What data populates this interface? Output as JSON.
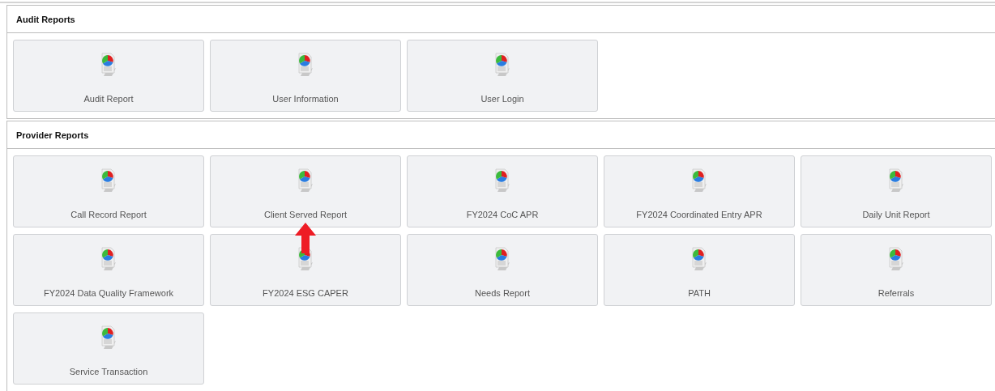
{
  "sections": [
    {
      "title": "Audit Reports",
      "tiles": [
        {
          "label": "Audit Report",
          "marked": false
        },
        {
          "label": "User Information",
          "marked": false
        },
        {
          "label": "User Login",
          "marked": false
        }
      ]
    },
    {
      "title": "Provider Reports",
      "tiles": [
        {
          "label": "Call Record Report",
          "marked": false
        },
        {
          "label": "Client Served Report",
          "marked": true
        },
        {
          "label": "FY2024 CoC APR",
          "marked": false
        },
        {
          "label": "FY2024 Coordinated Entry APR",
          "marked": false
        },
        {
          "label": "Daily Unit Report",
          "marked": false
        },
        {
          "label": "FY2024 Data Quality Framework",
          "marked": false
        },
        {
          "label": "FY2024 ESG CAPER",
          "marked": false
        },
        {
          "label": "Needs Report",
          "marked": false
        },
        {
          "label": "PATH",
          "marked": false
        },
        {
          "label": "Referrals",
          "marked": false
        },
        {
          "label": "Service Transaction",
          "marked": false
        }
      ]
    }
  ]
}
